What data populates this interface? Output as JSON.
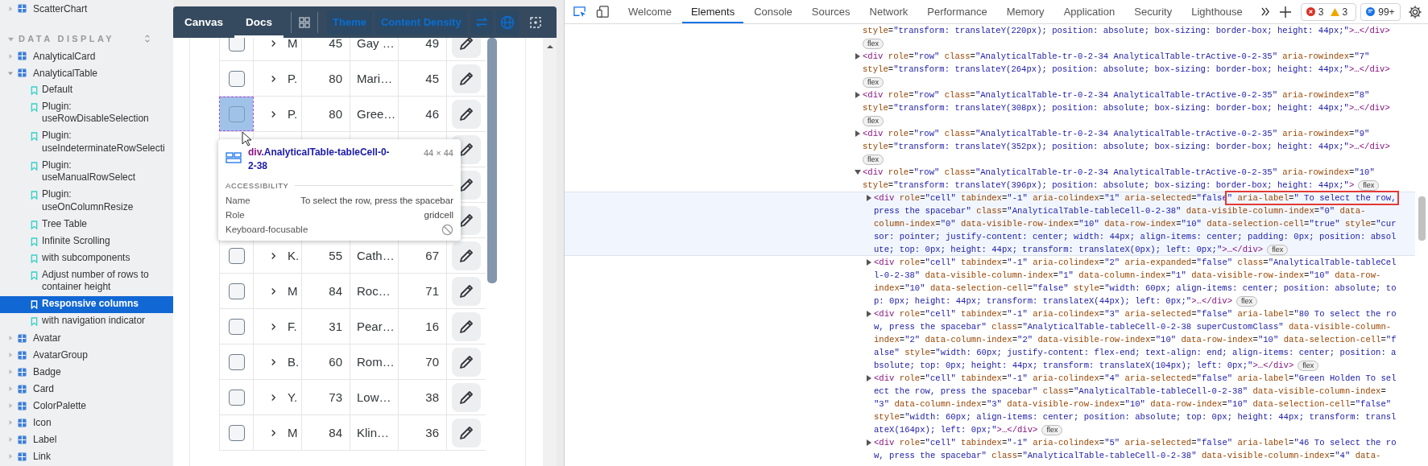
{
  "sidebar": {
    "items": [
      {
        "kind": "component",
        "label": "ScatterChart",
        "expanded": false
      },
      {
        "kind": "section",
        "label": "DATA DISPLAY",
        "expanded": true,
        "children": [
          {
            "kind": "component",
            "label": "AnalyticalCard",
            "expanded": false
          },
          {
            "kind": "component",
            "label": "AnalyticalTable",
            "expanded": true,
            "children": [
              {
                "kind": "story",
                "label": "Default",
                "selected": false
              },
              {
                "kind": "story",
                "label": "Plugin: useRowDisableSelection",
                "selected": false
              },
              {
                "kind": "story",
                "label": "Plugin: useIndeterminateRowSelecti",
                "selected": false
              },
              {
                "kind": "story",
                "label": "Plugin: useManualRowSelect",
                "selected": false
              },
              {
                "kind": "story",
                "label": "Plugin: useOnColumnResize",
                "selected": false
              },
              {
                "kind": "story",
                "label": "Tree Table",
                "selected": false
              },
              {
                "kind": "story",
                "label": "Infinite Scrolling",
                "selected": false
              },
              {
                "kind": "story",
                "label": "with subcomponents",
                "selected": false
              },
              {
                "kind": "story",
                "label": "Adjust number of rows to container height",
                "selected": false
              },
              {
                "kind": "story",
                "label": "Responsive columns",
                "selected": true
              },
              {
                "kind": "story",
                "label": "with navigation indicator",
                "selected": false
              }
            ]
          },
          {
            "kind": "component",
            "label": "Avatar",
            "expanded": false
          },
          {
            "kind": "component",
            "label": "AvatarGroup",
            "expanded": false
          },
          {
            "kind": "component",
            "label": "Badge",
            "expanded": false
          },
          {
            "kind": "component",
            "label": "Card",
            "expanded": false
          },
          {
            "kind": "component",
            "label": "ColorPalette",
            "expanded": false
          },
          {
            "kind": "component",
            "label": "Icon",
            "expanded": false
          },
          {
            "kind": "component",
            "label": "Label",
            "expanded": false
          },
          {
            "kind": "component",
            "label": "Link",
            "expanded": false
          }
        ]
      }
    ]
  },
  "toolbar": {
    "tabs": [
      {
        "label": "Canvas",
        "selected": false
      },
      {
        "label": "Docs",
        "selected": true
      }
    ],
    "theme_button": "Theme",
    "density_button": "Content Density"
  },
  "table": {
    "rows": [
      {
        "covered": false,
        "checked": false,
        "inspected": false,
        "cells": [
          "M",
          "45",
          "Gay …",
          "49"
        ]
      },
      {
        "covered": false,
        "checked": false,
        "inspected": false,
        "cells": [
          "P.",
          "80",
          "Mari…",
          "45"
        ]
      },
      {
        "covered": false,
        "checked": false,
        "inspected": true,
        "cells": [
          "P.",
          "80",
          "Gree…",
          "46"
        ]
      },
      {
        "covered": true
      },
      {
        "covered": true
      },
      {
        "covered": true
      },
      {
        "covered": false,
        "checked": false,
        "inspected": false,
        "cells": [
          "K.",
          "55",
          "Cath…",
          "67"
        ]
      },
      {
        "covered": false,
        "checked": false,
        "inspected": false,
        "cells": [
          "M",
          "84",
          "Roc…",
          "71"
        ]
      },
      {
        "covered": false,
        "checked": false,
        "inspected": false,
        "cells": [
          "F.",
          "31",
          "Pear…",
          "16"
        ]
      },
      {
        "covered": false,
        "checked": false,
        "inspected": false,
        "cells": [
          "B.",
          "60",
          "Rom…",
          "70"
        ]
      },
      {
        "covered": false,
        "checked": false,
        "inspected": false,
        "cells": [
          "Y.",
          "73",
          "Low…",
          "38"
        ]
      },
      {
        "covered": false,
        "checked": false,
        "inspected": false,
        "cells": [
          "M",
          "84",
          "Klin…",
          "36"
        ]
      }
    ]
  },
  "inspect_tooltip": {
    "tag": "div",
    "class_name": ".AnalyticalTable-tableCell-0-2-38",
    "size": "44 × 44",
    "section": "ACCESSIBILITY",
    "properties": [
      {
        "kind": "text",
        "name": "Name",
        "value": "To select the row, press the spacebar"
      },
      {
        "kind": "text",
        "name": "Role",
        "value": "gridcell"
      },
      {
        "kind": "flag",
        "name": "Keyboard-focusable",
        "on": false
      }
    ]
  },
  "devtools": {
    "tabs": [
      {
        "label": "Welcome",
        "selected": false
      },
      {
        "label": "Elements",
        "selected": true
      },
      {
        "label": "Console",
        "selected": false
      },
      {
        "label": "Sources",
        "selected": false
      },
      {
        "label": "Network",
        "selected": false
      },
      {
        "label": "Performance",
        "selected": false
      },
      {
        "label": "Memory",
        "selected": false
      },
      {
        "label": "Application",
        "selected": false
      },
      {
        "label": "Security",
        "selected": false
      },
      {
        "label": "Lighthouse",
        "selected": false
      }
    ],
    "errors": "3",
    "warnings": "3",
    "messages": "99+",
    "nodes": [
      {
        "selected": false,
        "lines": [
          "style=\"transform: translateY(220px); position: absolute; box-sizing: border-box; height: 44px;\">…</div>"
        ],
        "badge": "flex"
      },
      {
        "selected": false,
        "expanded": false,
        "lines": [
          "<div role=\"row\" class=\"AnalyticalTable-tr-0-2-34 AnalyticalTable-trActive-0-2-35\" aria-rowindex=\"7\"",
          "style=\"transform: translateY(264px); position: absolute; box-sizing: border-box; height: 44px;\">…</div>"
        ],
        "badge": "flex"
      },
      {
        "selected": false,
        "expanded": false,
        "lines": [
          "<div role=\"row\" class=\"AnalyticalTable-tr-0-2-34 AnalyticalTable-trActive-0-2-35\" aria-rowindex=\"8\"",
          "style=\"transform: translateY(308px); position: absolute; box-sizing: border-box; height: 44px;\">…</div>"
        ],
        "badge": "flex"
      },
      {
        "selected": false,
        "expanded": false,
        "lines": [
          "<div role=\"row\" class=\"AnalyticalTable-tr-0-2-34 AnalyticalTable-trActive-0-2-35\" aria-rowindex=\"9\"",
          "style=\"transform: translateY(352px); position: absolute; box-sizing: border-box; height: 44px;\">…</div>"
        ],
        "badge": "flex"
      },
      {
        "selected": false,
        "expanded": true,
        "lines": [
          "<div role=\"row\" class=\"AnalyticalTable-tr-0-2-34 AnalyticalTable-trActive-0-2-35\" aria-rowindex=\"10\"",
          "style=\"transform: translateY(396px); position: absolute; box-sizing: border-box; height: 44px;\">"
        ],
        "badge": "flex",
        "children": [
          {
            "selected": true,
            "expanded": false,
            "lines": [
              {
                "text": "<div role=\"cell\" tabindex=\"-1\" aria-colindex=\"1\" aria-selected=\"false",
                "boxed": "\" aria-label=\" To select the row,"
              },
              "press the spacebar\" class=\"AnalyticalTable-tableCell-0-2-38\" data-visible-column-index=\"0\" data-",
              "column-index=\"0\" data-visible-row-index=\"10\" data-row-index=\"10\" data-selection-cell=\"true\" style=\"cur",
              "sor: pointer; justify-content: center; width: 44px; align-items: center; padding: 0px; position: absol",
              "ute; top: 0px; height: 44px; transform: translateX(0px); left: 0px;\">…</div>"
            ],
            "badge": "flex"
          },
          {
            "selected": false,
            "expanded": false,
            "lines": [
              "<div role=\"cell\" tabindex=\"-1\" aria-colindex=\"2\" aria-expanded=\"false\" class=\"AnalyticalTable-tableCel",
              "l-0-2-38\" data-visible-column-index=\"1\" data-column-index=\"1\" data-visible-row-index=\"10\" data-row-",
              "index=\"10\" data-selection-cell=\"false\" style=\"width: 60px; align-items: center; position: absolute; to",
              "p: 0px; height: 44px; transform: translateX(44px); left: 0px;\">…</div>"
            ],
            "badge": "flex"
          },
          {
            "selected": false,
            "expanded": false,
            "lines": [
              "<div role=\"cell\" tabindex=\"-1\" aria-colindex=\"3\" aria-selected=\"false\" aria-label=\"80 To select the ro",
              "w, press the spacebar\" class=\"AnalyticalTable-tableCell-0-2-38 superCustomClass\" data-visible-column-",
              "index=\"2\" data-column-index=\"2\" data-visible-row-index=\"10\" data-row-index=\"10\" data-selection-cell=\"f",
              "alse\" style=\"width: 60px; justify-content: flex-end; text-align: end; align-items: center; position: a",
              "bsolute; top: 0px; height: 44px; transform: translateX(104px); left: 0px;\">…</div>"
            ],
            "badge": "flex"
          },
          {
            "selected": false,
            "expanded": false,
            "lines": [
              "<div role=\"cell\" tabindex=\"-1\" aria-colindex=\"4\" aria-selected=\"false\" aria-label=\"Green Holden To sel",
              "ect the row, press the spacebar\" class=\"AnalyticalTable-tableCell-0-2-38\" data-visible-column-index=",
              "\"3\" data-column-index=\"3\" data-visible-row-index=\"10\" data-row-index=\"10\" data-selection-cell=\"false\"",
              "style=\"width: 60px; align-items: center; position: absolute; top: 0px; height: 44px; transform: transl",
              "ateX(164px); left: 0px;\">…</div>"
            ],
            "badge": "flex"
          },
          {
            "selected": false,
            "expanded": false,
            "lines": [
              "<div role=\"cell\" tabindex=\"-1\" aria-colindex=\"5\" aria-selected=\"false\" aria-label=\"46 To select the ro",
              "w, press the spacebar\" class=\"AnalyticalTable-tableCell-0-2-38\" data-visible-column-index=\"4\" data-"
            ]
          }
        ]
      }
    ]
  }
}
